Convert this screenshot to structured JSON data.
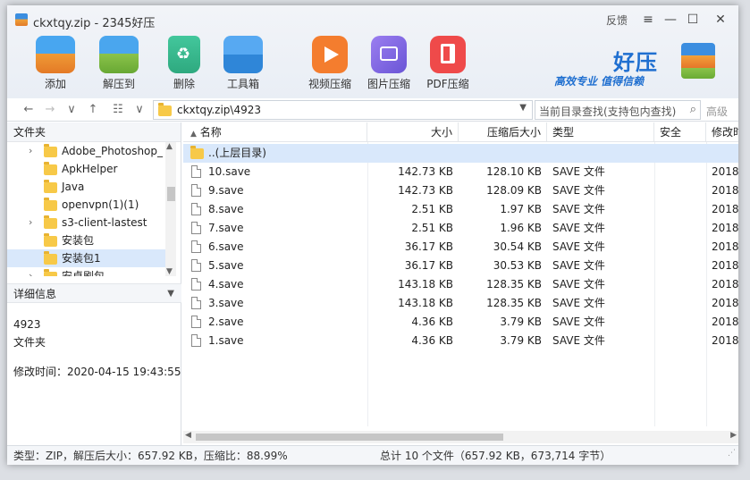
{
  "window": {
    "title": "ckxtqy.zip - 2345好压",
    "feedback": "反馈",
    "controls": {
      "menu": "≡",
      "minimize": "—",
      "maximize": "☐",
      "close": "✕"
    }
  },
  "toolbar": {
    "add": "添加",
    "extract": "解压到",
    "delete": "删除",
    "tools": "工具箱",
    "video": "视频压缩",
    "image": "图片压缩",
    "pdf": "PDF压缩"
  },
  "brand": {
    "title": "好压",
    "slogan": "高效专业 值得信赖"
  },
  "nav": {
    "back": "←",
    "forward": "→",
    "dropdown": "∨",
    "up": "↑",
    "view": "☷",
    "view_dropdown": "∨",
    "address": "ckxtqy.zip\\4923",
    "search_placeholder": "当前目录查找(支持包内查找)",
    "advanced": "高级"
  },
  "left": {
    "folder_header": "文件夹",
    "tree": [
      {
        "label": "Adobe_Photoshop_",
        "arrow": "›"
      },
      {
        "label": "ApkHelper",
        "arrow": ""
      },
      {
        "label": "Java",
        "arrow": ""
      },
      {
        "label": "openvpn(1)(1)",
        "arrow": ""
      },
      {
        "label": "s3-client-lastest",
        "arrow": "›"
      },
      {
        "label": "安装包",
        "arrow": ""
      },
      {
        "label": "安装包1",
        "arrow": ""
      },
      {
        "label": "安卓刷包",
        "arrow": "›"
      }
    ],
    "detail_header": "详细信息",
    "detail_name": "4923",
    "detail_type": "文件夹",
    "detail_mtime": "修改时间：2020-04-15 19:43:55"
  },
  "list": {
    "columns": {
      "name": "名称",
      "size": "大小",
      "packed": "压缩后大小",
      "type": "类型",
      "security": "安全",
      "mtime": "修改时"
    },
    "parent": "..(上层目录)",
    "rows": [
      {
        "name": "10.save",
        "size": "142.73 KB",
        "packed": "128.10 KB",
        "type": "SAVE 文件",
        "mtime": "2018-"
      },
      {
        "name": "9.save",
        "size": "142.73 KB",
        "packed": "128.09 KB",
        "type": "SAVE 文件",
        "mtime": "2018-"
      },
      {
        "name": "8.save",
        "size": "2.51 KB",
        "packed": "1.97 KB",
        "type": "SAVE 文件",
        "mtime": "2018-"
      },
      {
        "name": "7.save",
        "size": "2.51 KB",
        "packed": "1.96 KB",
        "type": "SAVE 文件",
        "mtime": "2018-"
      },
      {
        "name": "6.save",
        "size": "36.17 KB",
        "packed": "30.54 KB",
        "type": "SAVE 文件",
        "mtime": "2018-"
      },
      {
        "name": "5.save",
        "size": "36.17 KB",
        "packed": "30.53 KB",
        "type": "SAVE 文件",
        "mtime": "2018-"
      },
      {
        "name": "4.save",
        "size": "143.18 KB",
        "packed": "128.35 KB",
        "type": "SAVE 文件",
        "mtime": "2018-"
      },
      {
        "name": "3.save",
        "size": "143.18 KB",
        "packed": "128.35 KB",
        "type": "SAVE 文件",
        "mtime": "2018-"
      },
      {
        "name": "2.save",
        "size": "4.36 KB",
        "packed": "3.79 KB",
        "type": "SAVE 文件",
        "mtime": "2018-"
      },
      {
        "name": "1.save",
        "size": "4.36 KB",
        "packed": "3.79 KB",
        "type": "SAVE 文件",
        "mtime": "2018-"
      }
    ]
  },
  "status": {
    "left": "类型：ZIP，解压后大小：657.92 KB，压缩比：88.99%",
    "right": "总计 10 个文件（657.92 KB，673,714 字节）"
  }
}
